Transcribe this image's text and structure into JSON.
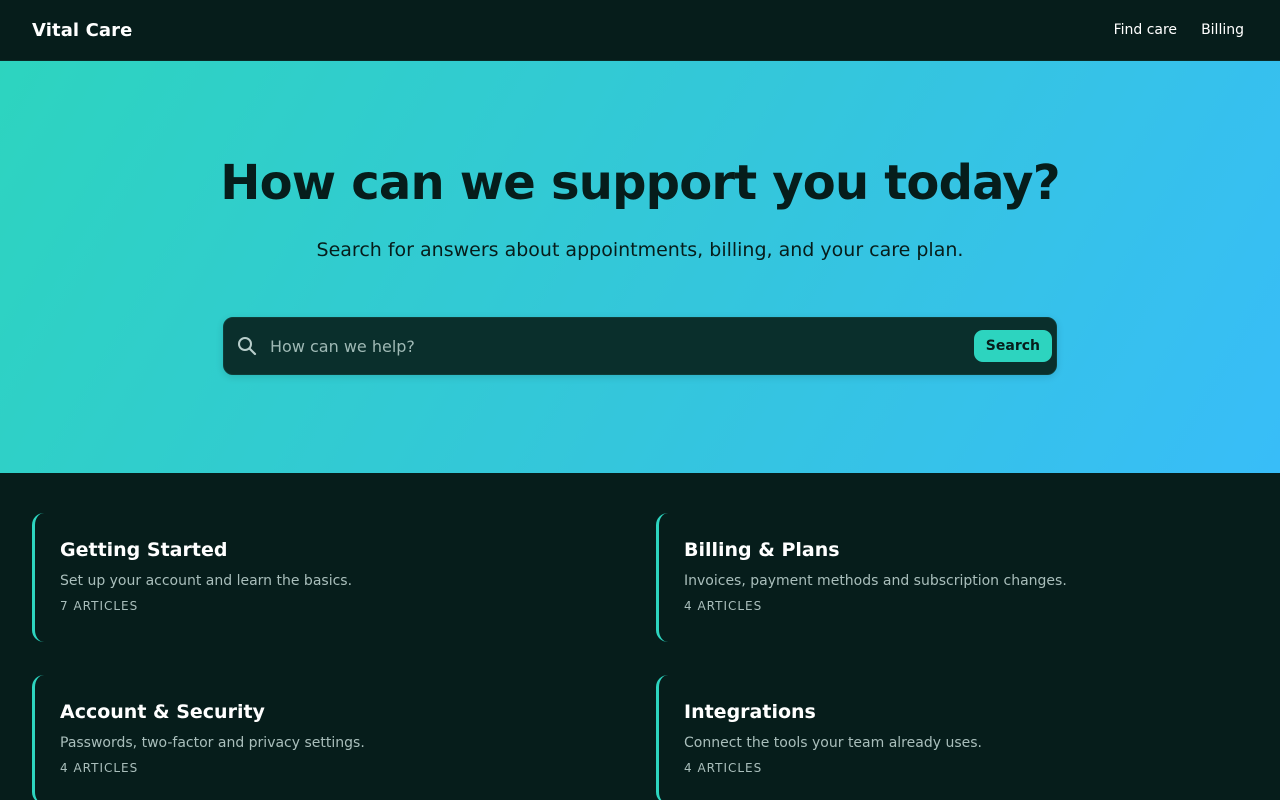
{
  "header": {
    "brand": "Vital Care",
    "nav": [
      {
        "label": "Find care"
      },
      {
        "label": "Billing"
      }
    ]
  },
  "hero": {
    "title": "How can we support you today?",
    "subtitle": "Search for answers about appointments, billing, and your care plan.",
    "search": {
      "placeholder": "How can we help?",
      "value": "",
      "button_label": "Search",
      "icon": "search-icon"
    }
  },
  "categories": [
    {
      "title": "Getting Started",
      "description": "Set up your account and learn the basics.",
      "count": "7 ARTICLES"
    },
    {
      "title": "Billing & Plans",
      "description": "Invoices, payment methods and subscription changes.",
      "count": "4 ARTICLES"
    },
    {
      "title": "Account & Security",
      "description": "Passwords, two-factor and privacy settings.",
      "count": "4 ARTICLES"
    },
    {
      "title": "Integrations",
      "description": "Connect the tools your team already uses.",
      "count": "4 ARTICLES"
    }
  ],
  "colors": {
    "background": "#061d1b",
    "accent": "#2dd4bf",
    "gradient_end": "#38bdf8",
    "search_bg": "#0a2f2c",
    "muted_text": "#a9bebb"
  }
}
